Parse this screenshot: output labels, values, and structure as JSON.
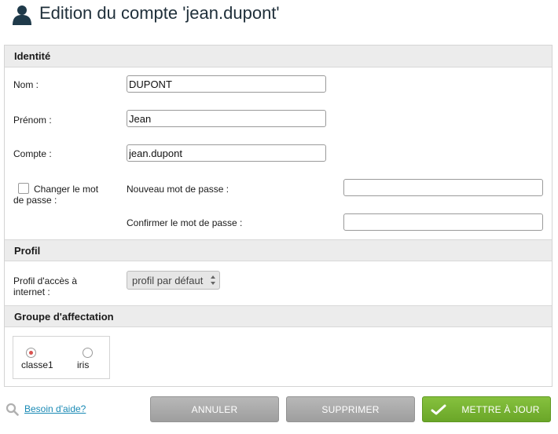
{
  "header": {
    "title": "Edition du compte 'jean.dupont'"
  },
  "sections": {
    "identite": "Identité",
    "profil": "Profil",
    "groupe": "Groupe d'affectation"
  },
  "fields": {
    "nom": {
      "label": "Nom :",
      "value": "DUPONT"
    },
    "prenom": {
      "label": "Prénom :",
      "value": "Jean"
    },
    "compte": {
      "label": "Compte :",
      "value": "jean.dupont"
    },
    "change_pw": {
      "label_line1": "Changer le mot",
      "label_line2": "de passe :",
      "checked": false
    },
    "new_pw": {
      "label": "Nouveau mot de passe :",
      "value": ""
    },
    "confirm_pw": {
      "label": "Confirmer le mot de passe :",
      "value": ""
    },
    "profil_acces": {
      "label_line1": "Profil d'accès à",
      "label_line2": "internet :",
      "selected": "profil par défaut"
    }
  },
  "groups": [
    {
      "label": "classe1",
      "selected": true
    },
    {
      "label": "iris",
      "selected": false
    }
  ],
  "footer": {
    "help": "Besoin d'aide?",
    "cancel": "ANNULER",
    "delete": "SUPPRIMER",
    "update": "METTRE À JOUR"
  },
  "colors": {
    "accent_green": "#78b232",
    "button_gray": "#a9a9a9",
    "link": "#1a8ab5",
    "radio_selected": "#d9534f"
  },
  "icons": {
    "header": "user-icon",
    "help": "search-icon",
    "update": "check-icon"
  }
}
